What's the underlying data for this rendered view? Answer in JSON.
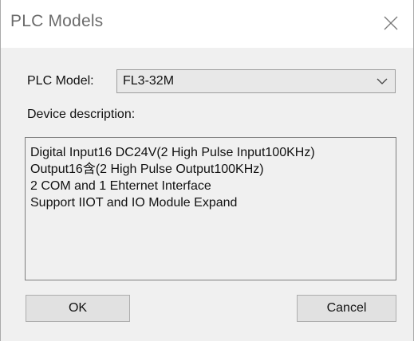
{
  "window": {
    "title": "PLC Models",
    "close_icon": "close-icon"
  },
  "form": {
    "plc_model_label": "PLC Model:",
    "plc_model_value": "FL3-32M",
    "dropdown_icon": "chevron-down-icon",
    "description_label": "Device description:",
    "description_lines": [
      "Digital Input16 DC24V(2 High Pulse Input100KHz)",
      "Output16含(2 High Pulse Output100KHz)",
      "2 COM and 1 Ehternet Interface",
      "Support IIOT and IO Module Expand"
    ]
  },
  "buttons": {
    "ok": "OK",
    "cancel": "Cancel"
  },
  "colors": {
    "client_bg": "#f0f0f0",
    "button_bg": "#e1e1e1",
    "title_text": "#6b6b6b"
  }
}
